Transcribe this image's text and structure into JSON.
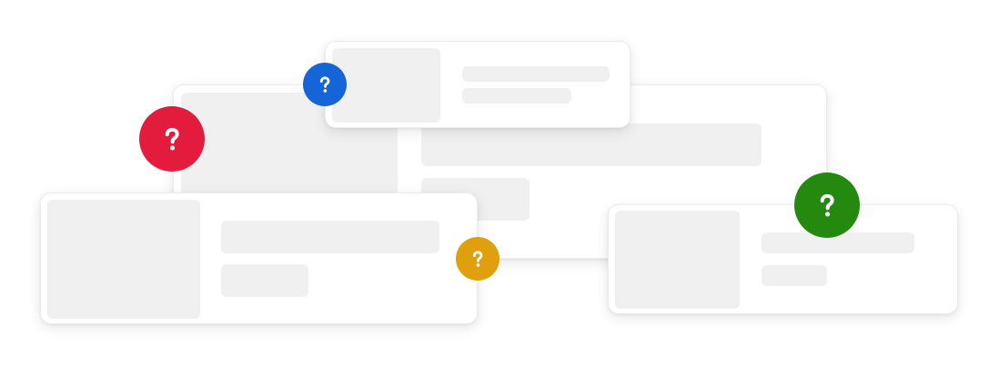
{
  "badges": [
    {
      "icon": "question-mark-icon",
      "color": "#e31c3d"
    },
    {
      "icon": "question-mark-icon",
      "color": "#1565d8"
    },
    {
      "icon": "question-mark-icon",
      "color": "#e0a00d"
    },
    {
      "icon": "question-mark-icon",
      "color": "#24890f"
    }
  ],
  "colors": {
    "card_background": "#ffffff",
    "placeholder_block": "#f0f0f0",
    "card_border": "#ededed",
    "glyph": "#ffffff"
  }
}
